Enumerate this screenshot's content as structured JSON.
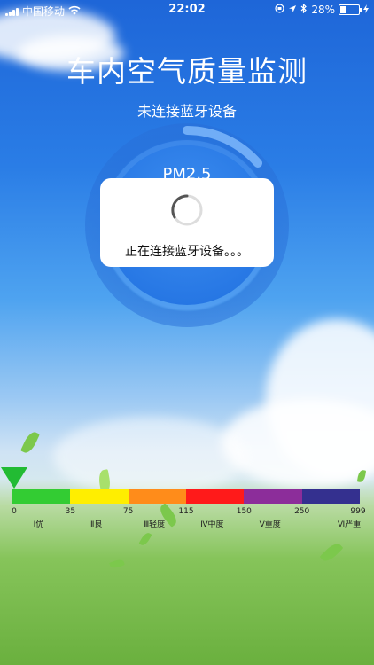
{
  "status_bar": {
    "carrier": "中国移动",
    "time": "22:02",
    "battery_percent": "28%",
    "battery_level": 0.28
  },
  "title": "车内空气质量监测",
  "connection_status": "未连接蓝牙设备",
  "gauge": {
    "label": "PM2.5"
  },
  "dialog": {
    "message": "正在连接蓝牙设备。。。"
  },
  "scale": {
    "colors": [
      "#33cc33",
      "#ffee00",
      "#ff8c1a",
      "#ff1a1a",
      "#8c2d9a",
      "#34308f"
    ],
    "ticks": [
      "0",
      "35",
      "75",
      "115",
      "150",
      "250",
      "999"
    ],
    "levels": [
      "Ⅰ优",
      "Ⅱ良",
      "Ⅲ轻度",
      "Ⅳ中度",
      "Ⅴ重度",
      "Ⅵ严重"
    ]
  }
}
